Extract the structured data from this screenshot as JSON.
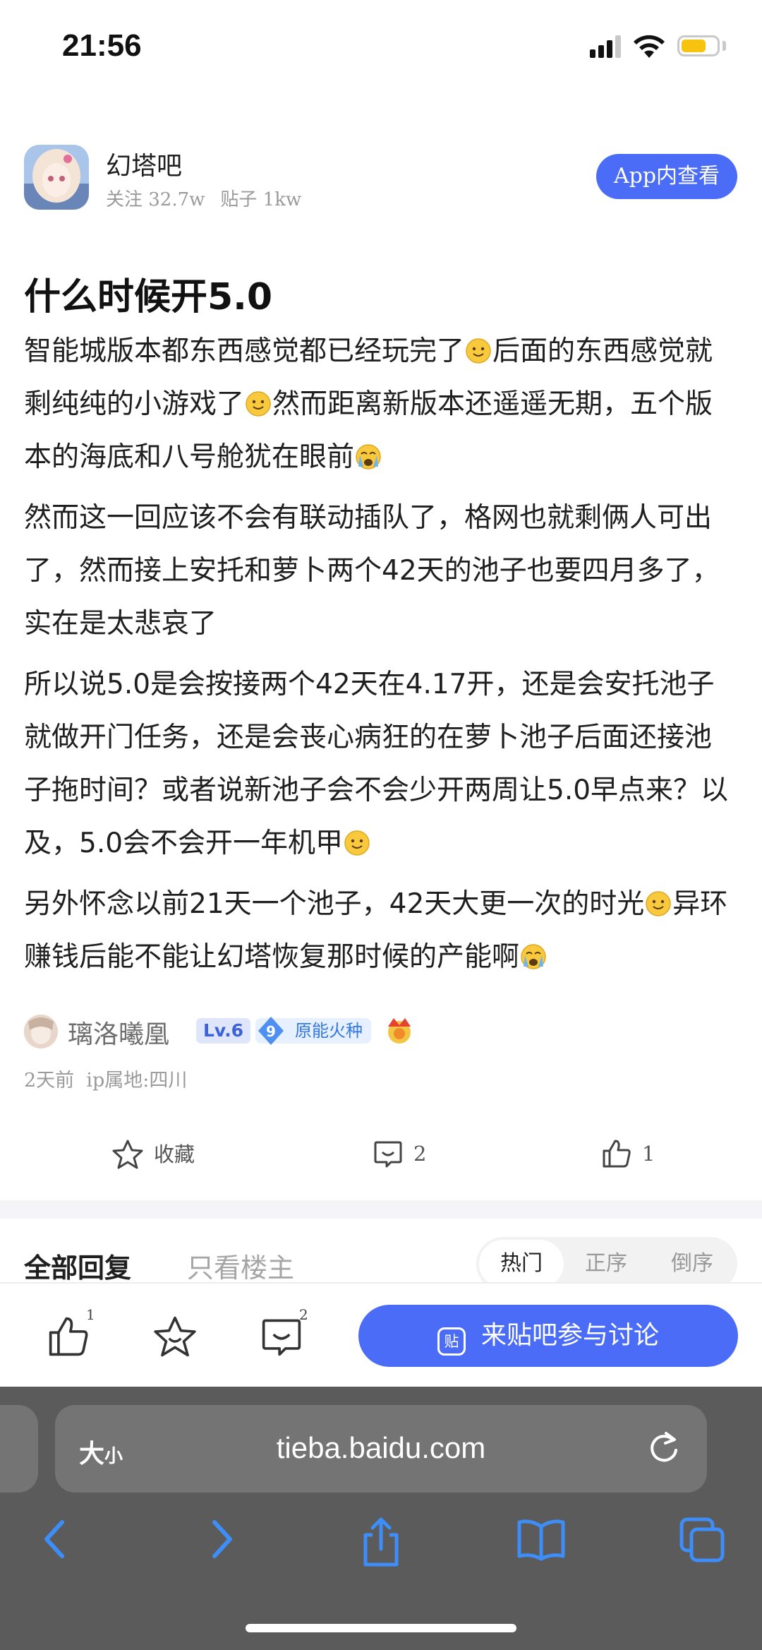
{
  "status_bar": {
    "time": "21:56",
    "battery_level": 0.7
  },
  "forum": {
    "name": "幻塔吧",
    "followers": "关注 32.7w",
    "posts": "贴子 1kw",
    "app_button": "App内查看"
  },
  "post": {
    "title": "什么时候开5.0",
    "paragraphs": [
      {
        "parts": [
          "智能城版本都东西感觉都已经玩完了",
          "后面的东西感觉就剩纯纯的小游戏了",
          "然而距离新版本还遥遥无期，五个版本的海底和八号舱犹在眼前",
          ""
        ],
        "emojis": [
          "smile",
          "smile",
          "cry"
        ]
      },
      {
        "parts": [
          "然而这一回应该不会有联动插队了，格网也就剩俩人可出了，然而接上安托和萝卜两个42天的池子也要四月多了，实在是太悲哀了"
        ],
        "emojis": []
      },
      {
        "parts": [
          "所以说5.0是会按接两个42天在4.17开，还是会安托池子就做开门任务，还是会丧心病狂的在萝卜池子后面还接池子拖时间？或者说新池子会不会少开两周让5.0早点来？以及，5.0会不会开一年机甲",
          ""
        ],
        "emojis": [
          "smile"
        ]
      },
      {
        "parts": [
          "另外怀念以前21天一个池子，42天大更一次的时光",
          "异环赚钱后能不能让幻塔恢复那时候的产能啊",
          ""
        ],
        "emojis": [
          "smile",
          "cry"
        ]
      }
    ],
    "author": {
      "name": "璃洛曦凰",
      "level": "Lv.6",
      "badge_number": "9",
      "badge_label": "原能火种"
    },
    "time_ago": "2天前",
    "ip_location": "ip属地:四川",
    "actions": {
      "favorite": "收藏",
      "comments": "2",
      "likes": "1"
    }
  },
  "reply_tabs": {
    "all": "全部回复",
    "op_only": "只看楼主",
    "sort": [
      "热门",
      "正序",
      "倒序"
    ]
  },
  "bottom_bar": {
    "like_count": "1",
    "comment_count": "2",
    "join_label": "来贴吧参与讨论",
    "join_icon": "贴"
  },
  "browser": {
    "text_size": "大",
    "text_size_small": "小",
    "url": "tieba.baidu.com"
  },
  "icons": [
    "signal-icon",
    "wifi-icon",
    "battery-icon",
    "star-icon",
    "comment-icon",
    "thumb-up-icon",
    "reload-icon",
    "back-icon",
    "forward-icon",
    "share-icon",
    "bookmarks-icon",
    "tabs-icon"
  ],
  "colors": {
    "accent": "#4a6cf7",
    "browser_bar": "#5b5b5b"
  }
}
